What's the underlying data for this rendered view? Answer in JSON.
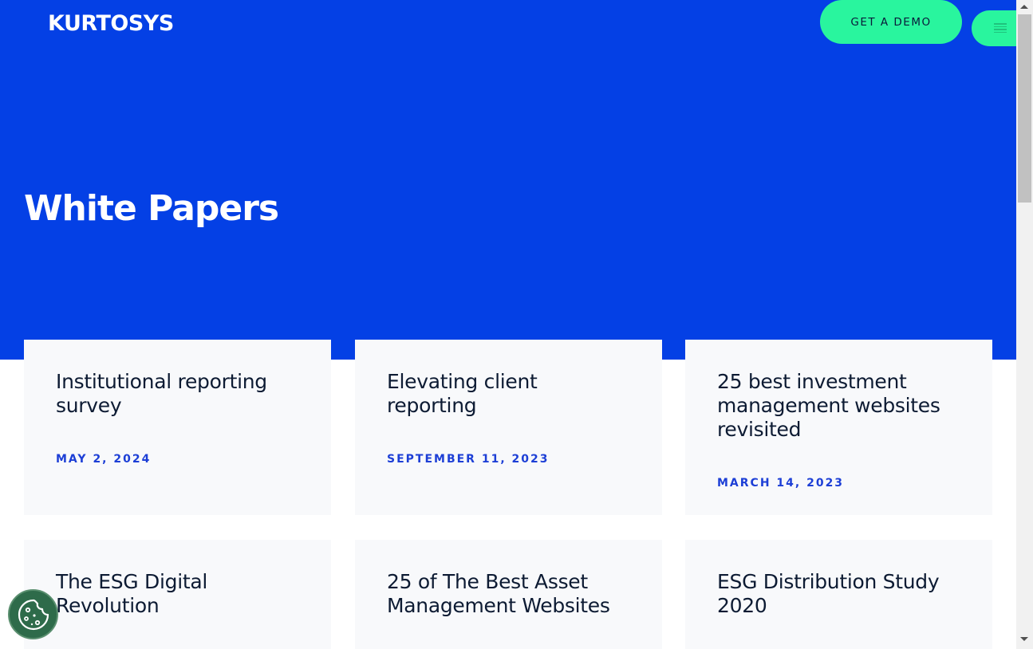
{
  "header": {
    "logo": "KURTOSYS",
    "demo_button": "GET A DEMO",
    "menu_icon": "hamburger-menu-icon"
  },
  "hero": {
    "title": "White Papers"
  },
  "papers": [
    {
      "title": "Institutional reporting survey",
      "date": "MAY 2, 2024"
    },
    {
      "title": "Elevating client reporting",
      "date": "SEPTEMBER 11, 2023"
    },
    {
      "title": "25 best investment management websites revisited",
      "date": "MARCH 14, 2023"
    },
    {
      "title": "The ESG Digital Revolution",
      "date": ""
    },
    {
      "title": "25 of The Best Asset Management Websites",
      "date": ""
    },
    {
      "title": "ESG Distribution Study 2020",
      "date": ""
    }
  ],
  "cookie_button": {
    "icon": "cookie-icon"
  },
  "colors": {
    "hero_bg": "#0440e5",
    "accent_green": "#29f59e",
    "date_blue": "#1d3fd6",
    "card_bg": "#f8f9fb",
    "cookie_green": "#2e6b4a"
  }
}
